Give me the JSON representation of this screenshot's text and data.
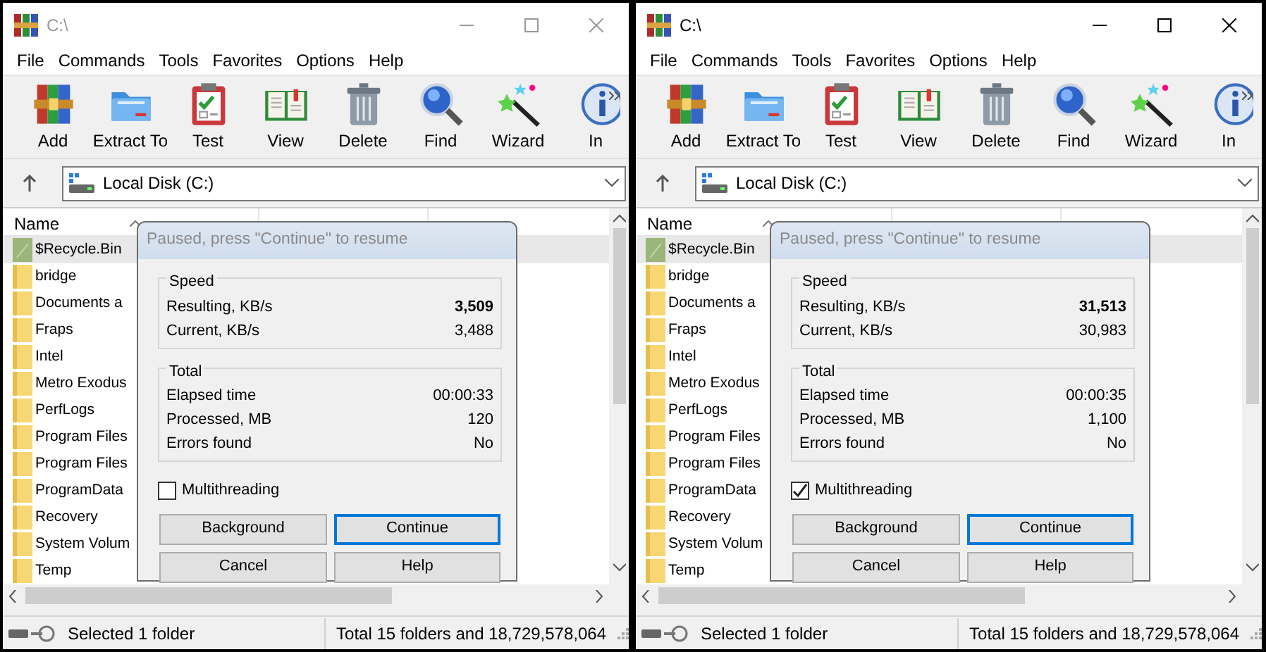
{
  "windows": [
    {
      "title": "C:\\",
      "active": false,
      "menu": [
        "File",
        "Commands",
        "Tools",
        "Favorites",
        "Options",
        "Help"
      ],
      "toolbar": [
        {
          "label": "Add",
          "kind": "add"
        },
        {
          "label": "Extract To",
          "kind": "extract"
        },
        {
          "label": "Test",
          "kind": "test"
        },
        {
          "label": "View",
          "kind": "view"
        },
        {
          "label": "Delete",
          "kind": "delete"
        },
        {
          "label": "Find",
          "kind": "find"
        },
        {
          "label": "Wizard",
          "kind": "wizard"
        },
        {
          "label": "In",
          "kind": "info"
        }
      ],
      "address": "Local Disk (C:)",
      "column": "Name",
      "files": [
        {
          "name": "$Recycle.Bin",
          "kind": "recycle",
          "selected": true
        },
        {
          "name": "bridge",
          "kind": "folder",
          "selected": false
        },
        {
          "name": "Documents a",
          "kind": "folder",
          "selected": false
        },
        {
          "name": "Fraps",
          "kind": "folder",
          "selected": false
        },
        {
          "name": "Intel",
          "kind": "folder",
          "selected": false
        },
        {
          "name": "Metro Exodus",
          "kind": "folder",
          "selected": false
        },
        {
          "name": "PerfLogs",
          "kind": "folder",
          "selected": false
        },
        {
          "name": "Program Files",
          "kind": "folder",
          "selected": false
        },
        {
          "name": "Program Files",
          "kind": "folder",
          "selected": false
        },
        {
          "name": "ProgramData",
          "kind": "folder",
          "selected": false
        },
        {
          "name": "Recovery",
          "kind": "folder",
          "selected": false
        },
        {
          "name": "System Volum",
          "kind": "folder",
          "selected": false
        },
        {
          "name": "Temp",
          "kind": "folder",
          "selected": false
        }
      ],
      "dialog": {
        "title": "Paused, press \"Continue\" to resume",
        "groups": [
          {
            "legend": "Speed",
            "rows": [
              {
                "label": "Resulting, KB/s",
                "value": "3,509",
                "bold": true
              },
              {
                "label": "Current, KB/s",
                "value": "3,488",
                "bold": false
              }
            ]
          },
          {
            "legend": "Total",
            "rows": [
              {
                "label": "Elapsed time",
                "value": "00:00:33",
                "bold": false
              },
              {
                "label": "Processed, MB",
                "value": "120",
                "bold": false
              },
              {
                "label": "Errors found",
                "value": "No",
                "bold": false
              }
            ]
          }
        ],
        "checkbox": {
          "label": "Multithreading",
          "checked": false
        },
        "buttons": [
          {
            "label": "Background",
            "focused": false
          },
          {
            "label": "Continue",
            "focused": true
          },
          {
            "label": "Cancel",
            "focused": false
          },
          {
            "label": "Help",
            "focused": false
          }
        ]
      },
      "status": {
        "selection": "Selected 1 folder",
        "total": "Total 15 folders and 18,729,578,064"
      }
    },
    {
      "title": "C:\\",
      "active": true,
      "menu": [
        "File",
        "Commands",
        "Tools",
        "Favorites",
        "Options",
        "Help"
      ],
      "toolbar": [
        {
          "label": "Add",
          "kind": "add"
        },
        {
          "label": "Extract To",
          "kind": "extract"
        },
        {
          "label": "Test",
          "kind": "test"
        },
        {
          "label": "View",
          "kind": "view"
        },
        {
          "label": "Delete",
          "kind": "delete"
        },
        {
          "label": "Find",
          "kind": "find"
        },
        {
          "label": "Wizard",
          "kind": "wizard"
        },
        {
          "label": "In",
          "kind": "info"
        }
      ],
      "address": "Local Disk (C:)",
      "column": "Name",
      "files": [
        {
          "name": "$Recycle.Bin",
          "kind": "recycle",
          "selected": true
        },
        {
          "name": "bridge",
          "kind": "folder",
          "selected": false
        },
        {
          "name": "Documents a",
          "kind": "folder",
          "selected": false
        },
        {
          "name": "Fraps",
          "kind": "folder",
          "selected": false
        },
        {
          "name": "Intel",
          "kind": "folder",
          "selected": false
        },
        {
          "name": "Metro Exodus",
          "kind": "folder",
          "selected": false
        },
        {
          "name": "PerfLogs",
          "kind": "folder",
          "selected": false
        },
        {
          "name": "Program Files",
          "kind": "folder",
          "selected": false
        },
        {
          "name": "Program Files",
          "kind": "folder",
          "selected": false
        },
        {
          "name": "ProgramData",
          "kind": "folder",
          "selected": false
        },
        {
          "name": "Recovery",
          "kind": "folder",
          "selected": false
        },
        {
          "name": "System Volum",
          "kind": "folder",
          "selected": false
        },
        {
          "name": "Temp",
          "kind": "folder",
          "selected": false
        }
      ],
      "dialog": {
        "title": "Paused, press \"Continue\" to resume",
        "groups": [
          {
            "legend": "Speed",
            "rows": [
              {
                "label": "Resulting, KB/s",
                "value": "31,513",
                "bold": true
              },
              {
                "label": "Current, KB/s",
                "value": "30,983",
                "bold": false
              }
            ]
          },
          {
            "legend": "Total",
            "rows": [
              {
                "label": "Elapsed time",
                "value": "00:00:35",
                "bold": false
              },
              {
                "label": "Processed, MB",
                "value": "1,100",
                "bold": false
              },
              {
                "label": "Errors found",
                "value": "No",
                "bold": false
              }
            ]
          }
        ],
        "checkbox": {
          "label": "Multithreading",
          "checked": true
        },
        "buttons": [
          {
            "label": "Background",
            "focused": false
          },
          {
            "label": "Continue",
            "focused": true
          },
          {
            "label": "Cancel",
            "focused": false
          },
          {
            "label": "Help",
            "focused": false
          }
        ]
      },
      "status": {
        "selection": "Selected 1 folder",
        "total": "Total 15 folders and 18,729,578,064"
      }
    }
  ]
}
